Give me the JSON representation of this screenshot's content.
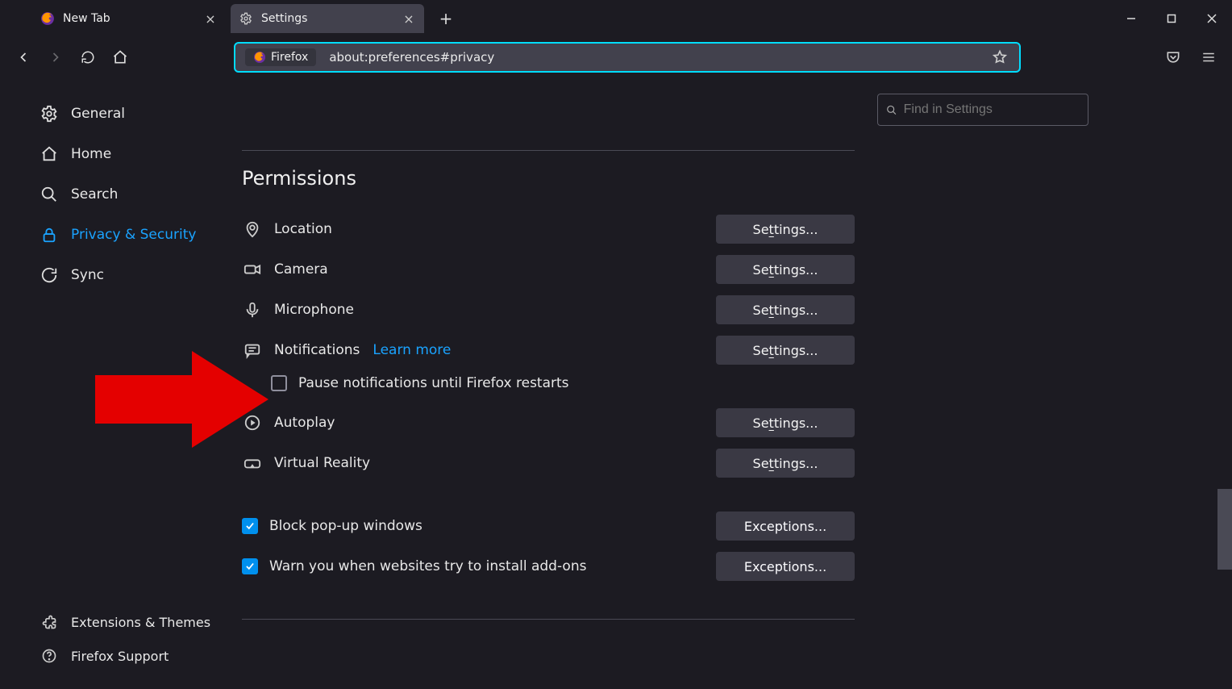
{
  "tabs": [
    {
      "label": "New Tab",
      "active": false
    },
    {
      "label": "Settings",
      "active": true
    }
  ],
  "urlbar": {
    "brand": "Firefox",
    "address": "about:preferences#privacy"
  },
  "search": {
    "placeholder": "Find in Settings"
  },
  "sidebar": {
    "items": [
      {
        "label": "General"
      },
      {
        "label": "Home"
      },
      {
        "label": "Search"
      },
      {
        "label": "Privacy & Security",
        "active": true
      },
      {
        "label": "Sync"
      }
    ],
    "footer": [
      {
        "label": "Extensions & Themes"
      },
      {
        "label": "Firefox Support"
      }
    ]
  },
  "section": {
    "title": "Permissions"
  },
  "permissions": {
    "location": {
      "label": "Location",
      "button": "Settings..."
    },
    "camera": {
      "label": "Camera",
      "button": "Settings..."
    },
    "microphone": {
      "label": "Microphone",
      "button": "Settings..."
    },
    "notifications": {
      "label": "Notifications",
      "learn": "Learn more",
      "button": "Settings...",
      "pause_label": "Pause notifications until Firefox restarts",
      "pause_checked": false
    },
    "autoplay": {
      "label": "Autoplay",
      "button": "Settings..."
    },
    "vr": {
      "label": "Virtual Reality",
      "button": "Settings..."
    }
  },
  "checks": {
    "popups": {
      "label": "Block pop-up windows",
      "checked": true,
      "button": "Exceptions..."
    },
    "addons": {
      "label": "Warn you when websites try to install add-ons",
      "checked": true,
      "button": "Exceptions..."
    }
  }
}
